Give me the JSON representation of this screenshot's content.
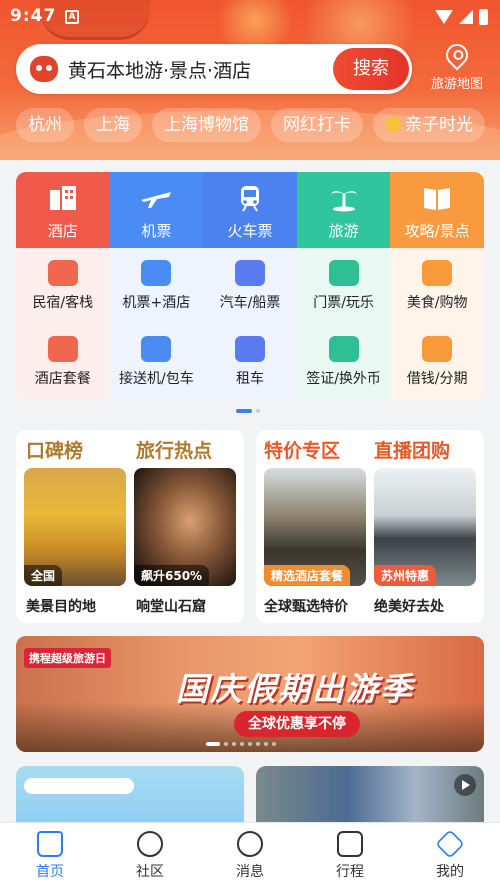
{
  "status": {
    "time": "9:47",
    "indicator": "A"
  },
  "search": {
    "placeholder": "黄石本地游·景点·酒店",
    "button": "搜索"
  },
  "map": {
    "label": "旅游地图"
  },
  "chips": [
    "杭州",
    "上海",
    "上海博物馆",
    "网红打卡",
    "亲子时光"
  ],
  "grid": {
    "top": [
      {
        "label": "酒店",
        "icon": "hotel-icon"
      },
      {
        "label": "机票",
        "icon": "plane-icon"
      },
      {
        "label": "火车票",
        "icon": "train-icon"
      },
      {
        "label": "旅游",
        "icon": "palm-tree-icon"
      },
      {
        "label": "攻略/景点",
        "icon": "book-icon"
      }
    ],
    "row2": [
      "民宿/客栈",
      "机票+酒店",
      "汽车/船票",
      "门票/玩乐",
      "美食/购物"
    ],
    "row3": [
      "酒店套餐",
      "接送机/包车",
      "租车",
      "签证/换外币",
      "借钱/分期"
    ]
  },
  "features": {
    "left": {
      "titles": [
        "口碑榜",
        "旅行热点"
      ],
      "items": [
        {
          "tag": "全国",
          "caption": "美景目的地"
        },
        {
          "tag": "飙升650%",
          "caption": "响堂山石窟"
        }
      ]
    },
    "right": {
      "titles": [
        "特价专区",
        "直播团购"
      ],
      "items": [
        {
          "tag": "精选酒店套餐",
          "caption": "全球甄选特价"
        },
        {
          "tag": "苏州特惠",
          "caption": "绝美好去处"
        }
      ]
    }
  },
  "banner": {
    "brand": "携程超级旅游日",
    "title": "国庆假期出游季",
    "subtitle": "全球优惠享不停"
  },
  "tabs": [
    "首页",
    "社区",
    "消息",
    "行程",
    "我的"
  ],
  "colors": {
    "brand": "#f0552e",
    "accent": "#2d7cf3"
  }
}
